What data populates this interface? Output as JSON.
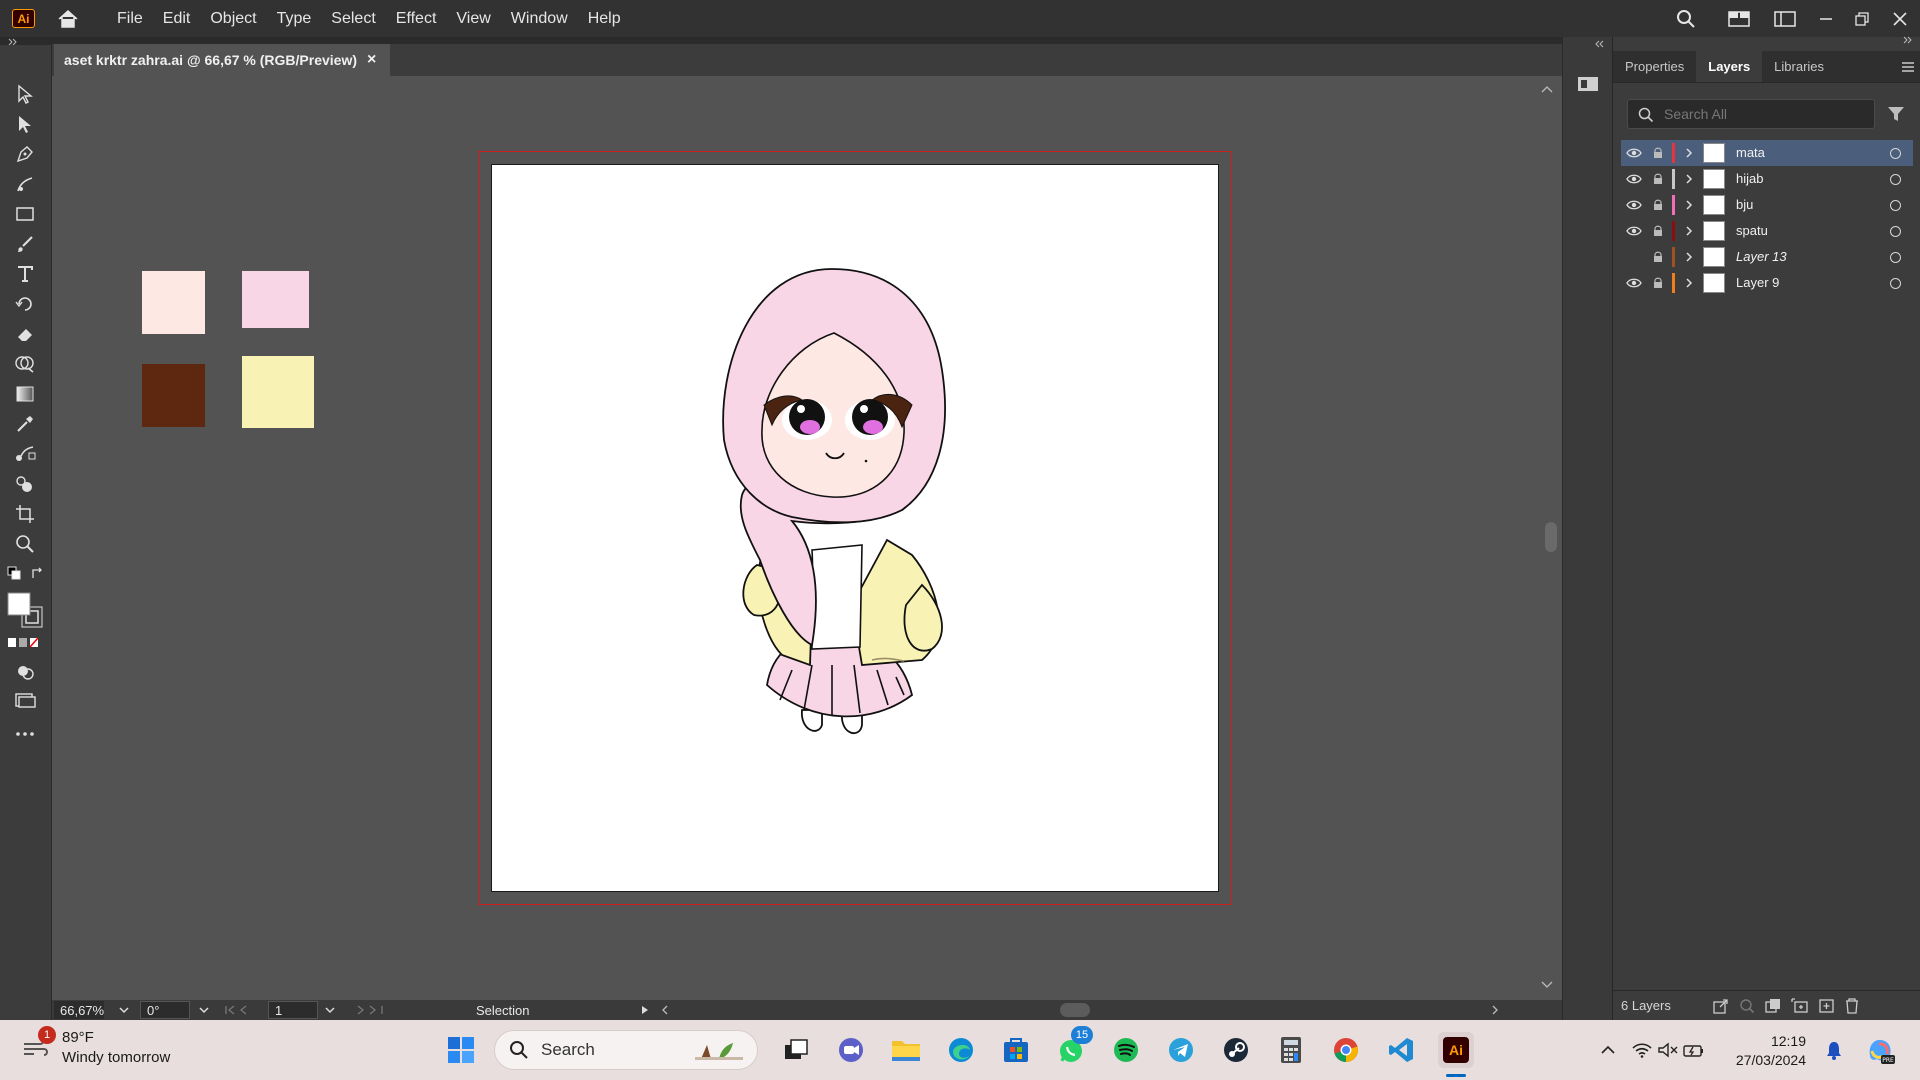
{
  "app": {
    "logo_text": "Ai",
    "menu": [
      "File",
      "Edit",
      "Object",
      "Type",
      "Select",
      "Effect",
      "View",
      "Window",
      "Help"
    ]
  },
  "document": {
    "tab_title": "aset krktr zahra.ai @ 66,67 % (RGB/Preview)",
    "close_glyph": "×"
  },
  "swatches": [
    {
      "name": "light-peach",
      "color": "#fde8e4"
    },
    {
      "name": "light-pink",
      "color": "#f9d6e6"
    },
    {
      "name": "dark-brown",
      "color": "#5e2710"
    },
    {
      "name": "pale-yellow",
      "color": "#f8f3b4"
    }
  ],
  "status": {
    "zoom": "66,67%",
    "rotation": "0°",
    "artboard_number": "1",
    "tool": "Selection"
  },
  "panel": {
    "tabs": [
      "Properties",
      "Layers",
      "Libraries"
    ],
    "active_tab": "Layers",
    "search_placeholder": "Search All",
    "layers": [
      {
        "name": "mata",
        "color": "#e7343c",
        "visible": true,
        "selected": true,
        "italic": false
      },
      {
        "name": "hijab",
        "color": "#c8c8c8",
        "visible": true,
        "selected": false,
        "italic": false
      },
      {
        "name": "bju",
        "color": "#f06fb9",
        "visible": true,
        "selected": false,
        "italic": false
      },
      {
        "name": "spatu",
        "color": "#8a1010",
        "visible": true,
        "selected": false,
        "italic": false
      },
      {
        "name": "Layer 13",
        "color": "#a0521e",
        "visible": false,
        "selected": false,
        "italic": true
      },
      {
        "name": "Layer 9",
        "color": "#f07e1c",
        "visible": true,
        "selected": false,
        "italic": false
      }
    ],
    "layer_count": "6 Layers"
  },
  "taskbar": {
    "weather_temp": "89°F",
    "weather_desc": "Windy tomorrow",
    "weather_badge": "1",
    "search_label": "Search",
    "whatsapp_badge": "15",
    "time": "12:19",
    "date": "27/03/2024"
  }
}
